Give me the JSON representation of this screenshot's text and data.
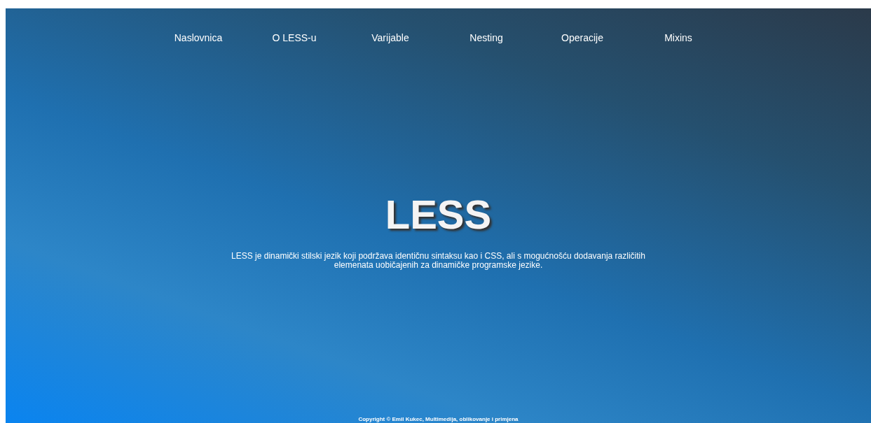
{
  "nav": [
    {
      "label": "Naslovnica"
    },
    {
      "label": "O LESS-u"
    },
    {
      "label": "Varijable"
    },
    {
      "label": "Nesting"
    },
    {
      "label": "Operacije"
    },
    {
      "label": "Mixins"
    }
  ],
  "hero": {
    "title": "LESS",
    "description": "LESS je dinamički stilski jezik koji podržava identičnu sintaksu kao i CSS, ali s mogućnošću dodavanja različitih elemenata uobičajenih za dinamičke programske jezike."
  },
  "footer": {
    "text": "Copyright © Emil Kukec, Multimedija, oblikovanje i primjena"
  }
}
